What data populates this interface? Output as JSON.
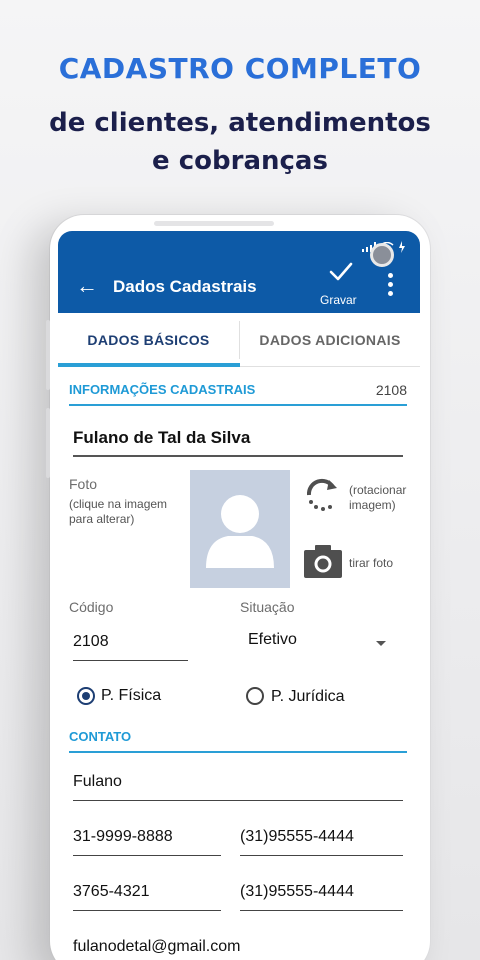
{
  "promo": {
    "title": "CADASTRO COMPLETO",
    "subtitle_line1": "de clientes, atendimentos",
    "subtitle_line2": "e cobranças"
  },
  "colors": {
    "accent": "#2a6fd8",
    "appbar": "#0d5aa7",
    "tab_indicator": "#2a9fd6",
    "section_label": "#1f9ad6",
    "dark_navy": "#1b1f4b"
  },
  "appbar": {
    "back_icon": "arrow-left-icon",
    "title": "Dados Cadastrais",
    "save_label": "Gravar",
    "save_icon": "check-icon",
    "menu_icon": "more-vert-icon"
  },
  "tabs": [
    {
      "label": "DADOS BÁSICOS",
      "active": true
    },
    {
      "label": "DADOS ADICIONAIS",
      "active": false
    }
  ],
  "sections": {
    "info_label": "INFORMAÇÕES CADASTRAIS",
    "info_number": "2108",
    "contact_label": "CONTATO"
  },
  "form": {
    "name": "Fulano de Tal da Silva",
    "photo_label": "Foto",
    "photo_hint": "(clique na imagem para alterar)",
    "rotate_label": "(rotacionar imagem)",
    "take_photo_label": "tirar foto",
    "code_label": "Código",
    "code_value": "2108",
    "status_label": "Situação",
    "status_value": "Efetivo",
    "person_type_options": [
      {
        "label": "P. Física",
        "selected": true
      },
      {
        "label": "P. Jurídica",
        "selected": false
      }
    ]
  },
  "contact": {
    "contact_name": "Fulano",
    "phone1": "31-9999-8888",
    "phone2": "(31)95555-4444",
    "phone3": "3765-4321",
    "phone4": "(31)95555-4444",
    "email": "fulanodetal@gmail.com"
  }
}
